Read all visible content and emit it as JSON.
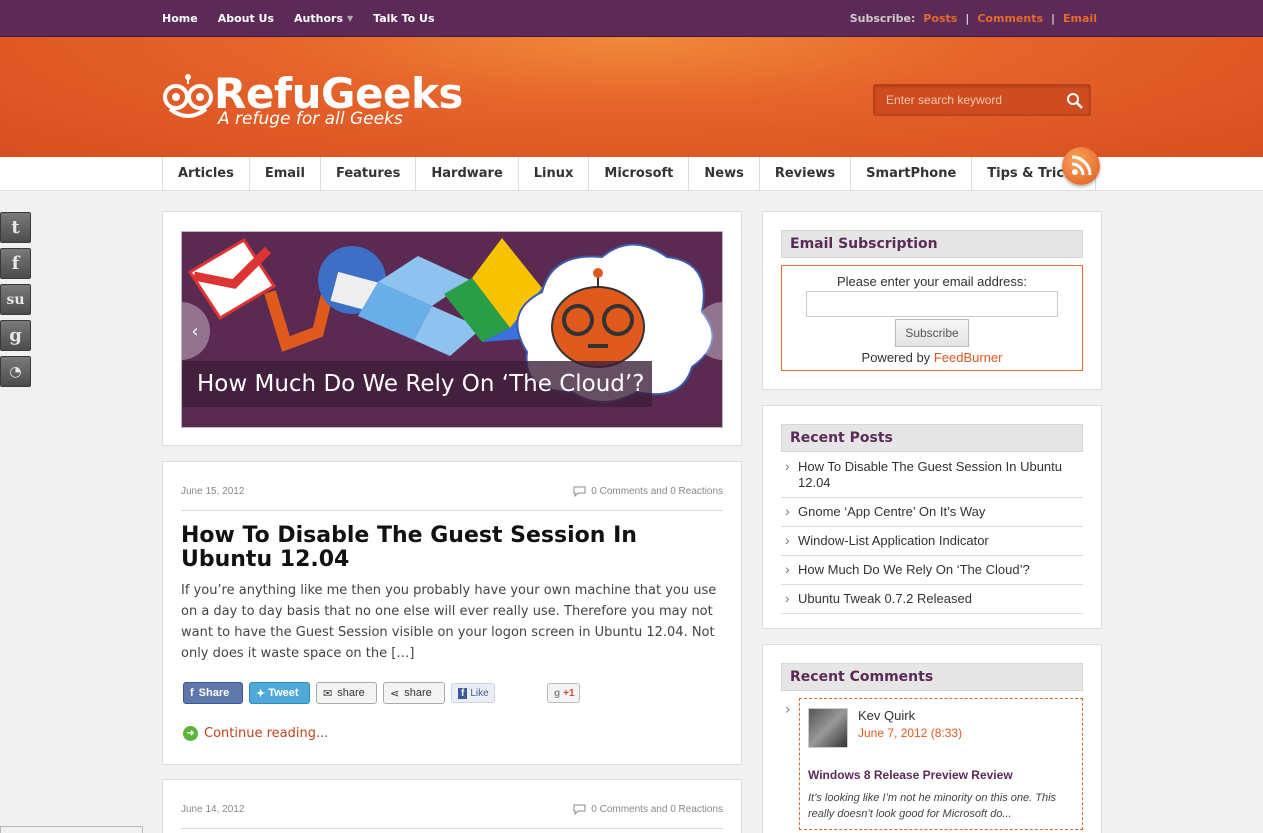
{
  "topnav": {
    "items": [
      "Home",
      "About Us",
      "Authors",
      "Talk To Us"
    ],
    "subscribe_label": "Subscribe:",
    "subscribe_links": [
      "Posts",
      "Comments",
      "Email"
    ]
  },
  "header": {
    "logo_text": "RefuGeeks",
    "tagline": "A refuge for all Geeks",
    "search_placeholder": "Enter search keyword"
  },
  "mainnav": {
    "items": [
      "Articles",
      "Email",
      "Features",
      "Hardware",
      "Linux",
      "Microsoft",
      "News",
      "Reviews",
      "SmartPhone",
      "Tips & Tricks"
    ]
  },
  "social": {
    "icons": [
      "twitter-icon",
      "facebook-icon",
      "stumbleupon-icon",
      "google-icon",
      "rss-icon"
    ]
  },
  "slider": {
    "caption": "How Much Do We Rely On ‘The Cloud’?",
    "prev": "‹",
    "next": "›"
  },
  "post1": {
    "date": "June 15, 2012",
    "comments": "0 Comments and 0 Reactions",
    "title": "How To Disable The Guest Session In Ubuntu 12.04",
    "excerpt": "If you’re anything like me then you probably have your own machine that you use on a day to day basis that no one else will ever really use. Therefore you may not want to have the Guest Session visible on your logon screen in Ubuntu 12.04. Not only does it waste space on the […]",
    "share_buttons": [
      "Share",
      "Tweet",
      "share",
      "share",
      "Like",
      "+1"
    ],
    "continue": "Continue reading..."
  },
  "post2": {
    "date": "June 14, 2012",
    "comments": "0 Comments and 0 Reactions"
  },
  "email_widget": {
    "title": "Email Subscription",
    "label": "Please enter your email address:",
    "button": "Subscribe",
    "powered_by": "Powered by",
    "powered_link": "FeedBurner"
  },
  "recent_posts": {
    "title": "Recent Posts",
    "items": [
      "How To Disable The Guest Session In Ubuntu 12.04",
      "Gnome ‘App Centre’ On It’s Way",
      "Window-List Application Indicator",
      "How Much Do We Rely On ‘The Cloud’?",
      "Ubuntu Tweak 0.7.2 Released"
    ]
  },
  "recent_comments": {
    "title": "Recent Comments",
    "name": "Kev Quirk",
    "date": "June 7, 2012 (8:33)",
    "post": "Windows 8 Release Preview Review",
    "excerpt": "It’s looking like I’m not he minority on this one. This really doesn’t look good for Microsoft do..."
  },
  "colors": {
    "topbar": "#5c2a56",
    "header": "#e6642a",
    "accent": "#e0581e"
  }
}
